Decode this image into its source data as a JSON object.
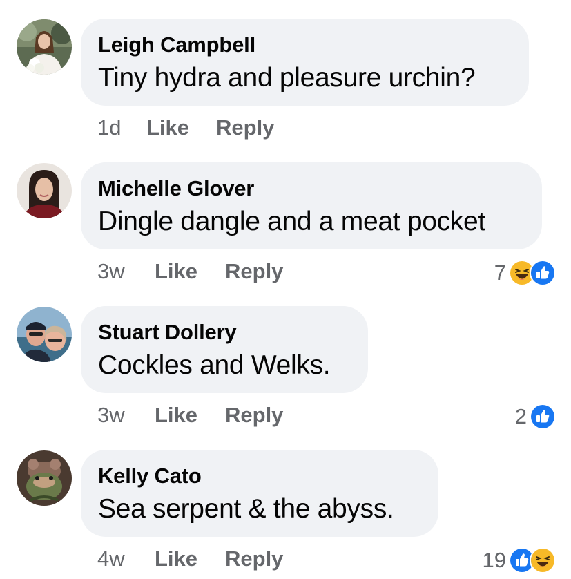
{
  "comments": [
    {
      "author": "Leigh Campbell",
      "text": "Tiny hydra and pleasure urchin?",
      "time": "1d",
      "like_label": "Like",
      "reply_label": "Reply",
      "reaction_count": "",
      "reactions": []
    },
    {
      "author": "Michelle Glover",
      "text": "Dingle dangle and a meat pocket",
      "time": "3w",
      "like_label": "Like",
      "reply_label": "Reply",
      "reaction_count": "7",
      "reactions": [
        "haha-icon",
        "like-icon"
      ]
    },
    {
      "author": "Stuart Dollery",
      "text": "Cockles and Welks.",
      "time": "3w",
      "like_label": "Like",
      "reply_label": "Reply",
      "reaction_count": "2",
      "reactions": [
        "like-icon"
      ]
    },
    {
      "author": "Kelly Cato",
      "text": "Sea serpent & the abyss.",
      "time": "4w",
      "like_label": "Like",
      "reply_label": "Reply",
      "reaction_count": "19",
      "reactions": [
        "like-icon",
        "haha-icon"
      ]
    }
  ],
  "colors": {
    "bubble_bg": "#f0f2f5",
    "text": "#050505",
    "secondary_text": "#65676b",
    "like_blue": "#1877f2",
    "haha_yellow": "#f7b928"
  }
}
